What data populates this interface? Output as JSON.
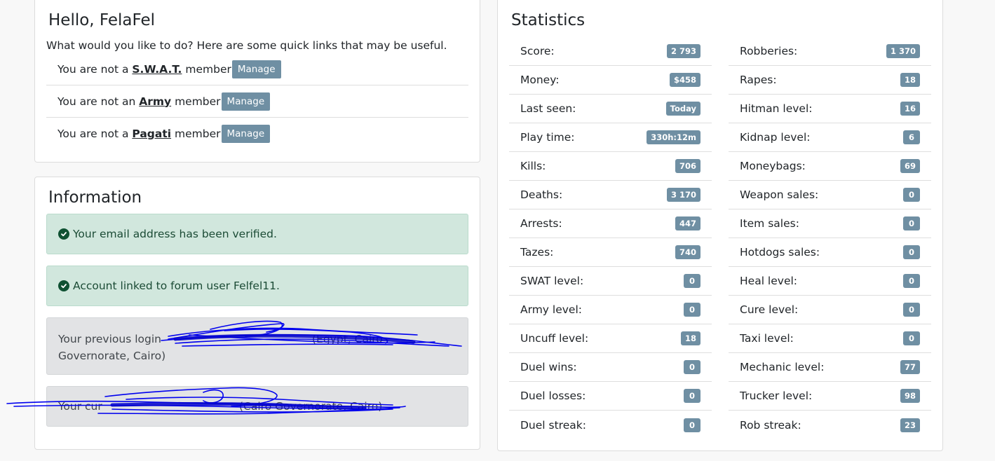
{
  "greeting": {
    "title": "Hello, FelaFel",
    "subtitle": "What would you like to do? Here are some quick links that may be useful.",
    "groups": [
      {
        "prefix": "You are not a",
        "name": "S.W.A.T.",
        "suffix": "member",
        "button": "Manage"
      },
      {
        "prefix": "You are not an",
        "name": "Army",
        "suffix": "member",
        "button": "Manage"
      },
      {
        "prefix": "You are not a",
        "name": "Pagati",
        "suffix": "member",
        "button": "Manage"
      }
    ]
  },
  "information": {
    "title": "Information",
    "alerts": [
      {
        "text": "Your email address has been verified.",
        "icon": "check-circle-icon"
      },
      {
        "text": "Account linked to forum user Felfel11.",
        "icon": "check-circle-icon"
      }
    ],
    "previous_login": {
      "line1": "Your previous login",
      "line1_end": "(Egypt, Cairo",
      "line2": "Governorate, Cairo)"
    },
    "current_login": {
      "start": "Your cur",
      "end": "(Cairo Governorate, Cairo)"
    }
  },
  "statistics": {
    "title": "Statistics",
    "left": [
      {
        "label": "Score:",
        "value": "2 793"
      },
      {
        "label": "Money:",
        "value": "$458"
      },
      {
        "label": "Last seen:",
        "value": "Today"
      },
      {
        "label": "Play time:",
        "value": "330h:12m"
      },
      {
        "label": "Kills:",
        "value": "706"
      },
      {
        "label": "Deaths:",
        "value": "3 170"
      },
      {
        "label": "Arrests:",
        "value": "447"
      },
      {
        "label": "Tazes:",
        "value": "740"
      },
      {
        "label": "SWAT level:",
        "value": "0"
      },
      {
        "label": "Army level:",
        "value": "0"
      },
      {
        "label": "Uncuff level:",
        "value": "18"
      },
      {
        "label": "Duel wins:",
        "value": "0"
      },
      {
        "label": "Duel losses:",
        "value": "0"
      },
      {
        "label": "Duel streak:",
        "value": "0"
      }
    ],
    "right": [
      {
        "label": "Robberies:",
        "value": "1 370"
      },
      {
        "label": "Rapes:",
        "value": "18"
      },
      {
        "label": "Hitman level:",
        "value": "16"
      },
      {
        "label": "Kidnap level:",
        "value": "6"
      },
      {
        "label": "Moneybags:",
        "value": "69"
      },
      {
        "label": "Weapon sales:",
        "value": "0"
      },
      {
        "label": "Item sales:",
        "value": "0"
      },
      {
        "label": "Hotdogs sales:",
        "value": "0"
      },
      {
        "label": "Heal level:",
        "value": "0"
      },
      {
        "label": "Cure level:",
        "value": "0"
      },
      {
        "label": "Taxi level:",
        "value": "0"
      },
      {
        "label": "Mechanic level:",
        "value": "77"
      },
      {
        "label": "Trucker level:",
        "value": "98"
      },
      {
        "label": "Rob streak:",
        "value": "23"
      }
    ]
  },
  "colors": {
    "badge": "#6f8fa3",
    "success_bg": "#d1e7dd",
    "gray_bg": "#e2e3e5",
    "scribble": "#0000ee"
  }
}
